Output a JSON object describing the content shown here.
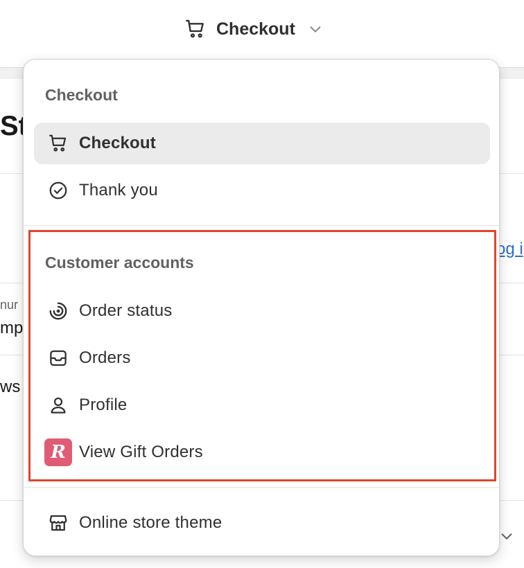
{
  "header": {
    "selected_page": "Checkout"
  },
  "background": {
    "title_fragment": "St",
    "link_fragment": "og i",
    "small_fragment": "nur",
    "text_fragment_1": "mp",
    "text_fragment_2": "ws"
  },
  "menu": {
    "sections": [
      {
        "heading": "Checkout",
        "items": [
          {
            "label": "Checkout",
            "icon": "cart-icon",
            "selected": true
          },
          {
            "label": "Thank you",
            "icon": "check-circle-icon",
            "selected": false
          }
        ]
      },
      {
        "heading": "Customer accounts",
        "highlighted": true,
        "highlight_color": "#e0442c",
        "items": [
          {
            "label": "Order status",
            "icon": "order-status-icon"
          },
          {
            "label": "Orders",
            "icon": "inbox-icon"
          },
          {
            "label": "Profile",
            "icon": "person-icon"
          },
          {
            "label": "View Gift Orders",
            "icon": "app-r-icon",
            "icon_text": "R",
            "icon_color": "#e05c74"
          }
        ]
      },
      {
        "items": [
          {
            "label": "Online store theme",
            "icon": "store-icon"
          }
        ]
      }
    ]
  }
}
